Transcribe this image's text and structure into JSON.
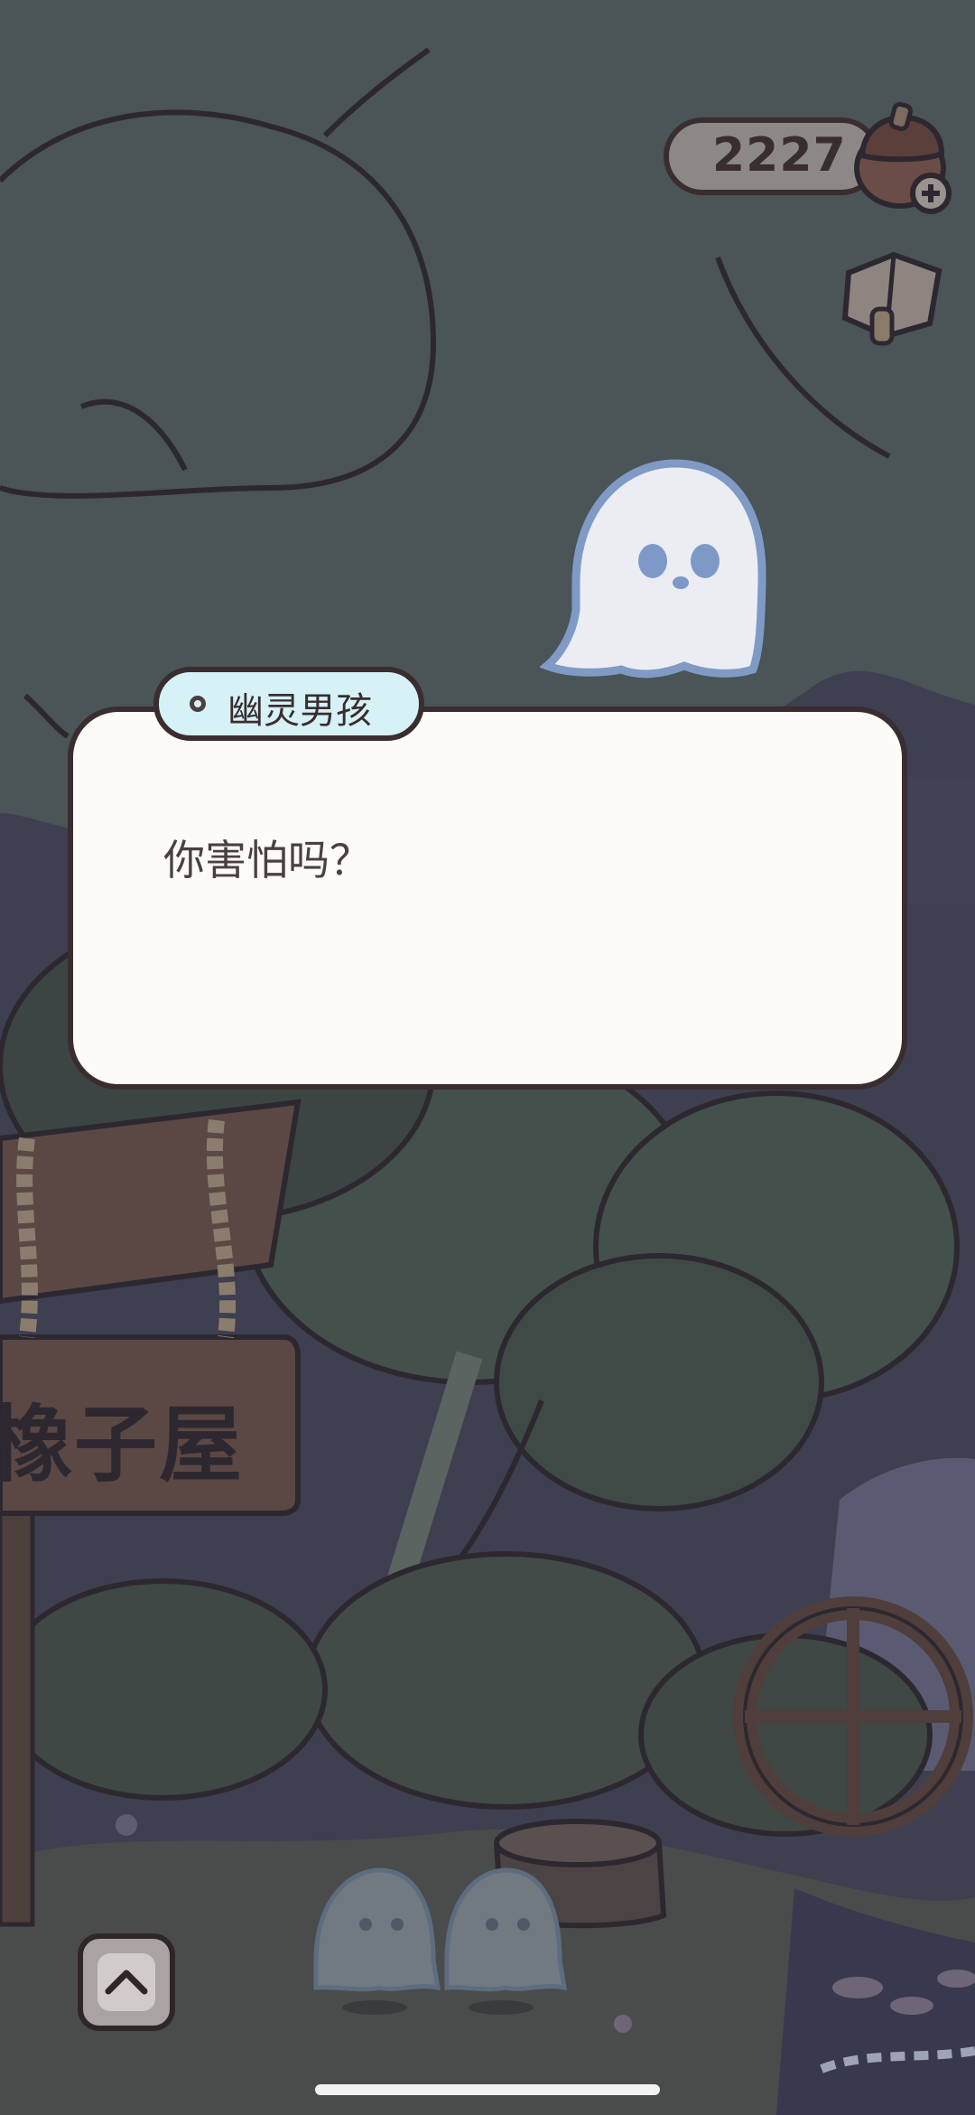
{
  "hud": {
    "currency_count": "2227",
    "currency_icon": "acorn-icon",
    "add_icon": "plus-icon",
    "menu_icon": "journal-icon"
  },
  "dialog": {
    "speaker_name": "幽灵男孩",
    "message": "你害怕吗？"
  },
  "sign": {
    "text": "橡子屋"
  },
  "controls": {
    "expand_icon": "chevron-up-icon"
  },
  "colors": {
    "dialog_bg": "#fdfbf7",
    "nametag_bg": "#d6f2f7",
    "outline": "#3a2d2f",
    "ghost_eye": "#7d9ac7"
  }
}
